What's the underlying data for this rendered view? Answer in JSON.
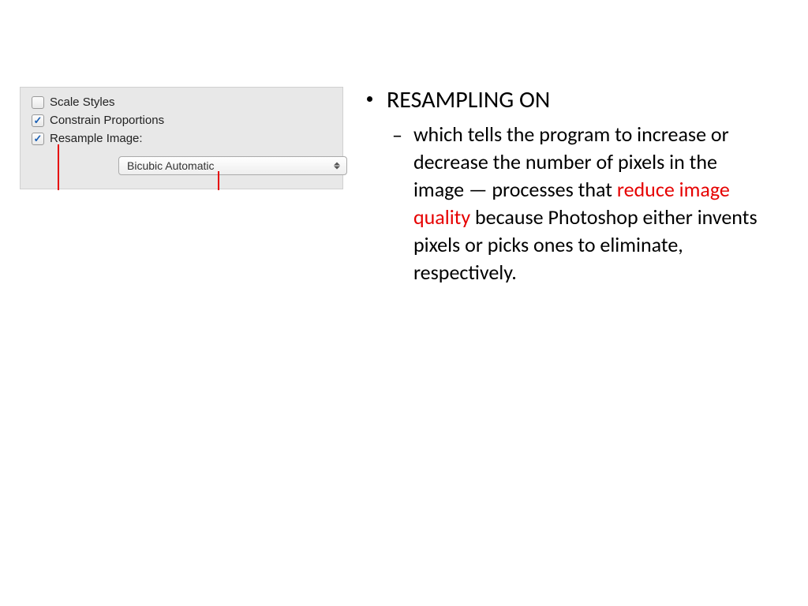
{
  "panel": {
    "scale_styles_label": "Scale Styles",
    "scale_styles_checked": false,
    "constrain_proportions_label": "Constrain Proportions",
    "constrain_proportions_checked": true,
    "resample_image_label": "Resample Image:",
    "resample_image_checked": true,
    "dropdown_value": "Bicubic Automatic"
  },
  "slide": {
    "title": "RESAMPLING ON",
    "sub_part1": "which tells the program to increase or decrease the number of pixels in the image — processes that ",
    "sub_red": "reduce image quality",
    "sub_part2": " because Photoshop either invents pixels or picks ones to eliminate, respectively."
  }
}
